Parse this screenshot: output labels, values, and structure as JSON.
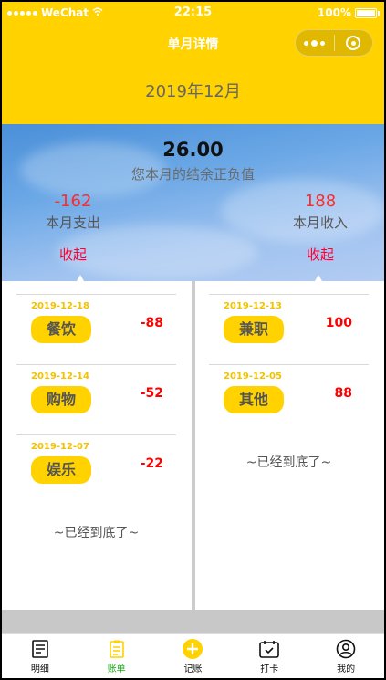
{
  "status_bar": {
    "carrier": "WeChat",
    "time": "22:15",
    "battery": "100%"
  },
  "nav": {
    "title": "单月详情"
  },
  "header": {
    "month": "2019年12月"
  },
  "summary": {
    "balance": "26.00",
    "balance_label": "您本月的结余正负值",
    "expense": {
      "value": "-162",
      "label": "本月支出",
      "fold": "收起"
    },
    "income": {
      "value": "188",
      "label": "本月收入",
      "fold": "收起"
    }
  },
  "expense_list": [
    {
      "date": "2019-12-18",
      "category": "餐饮",
      "amount": "-88"
    },
    {
      "date": "2019-12-14",
      "category": "购物",
      "amount": "-52"
    },
    {
      "date": "2019-12-07",
      "category": "娱乐",
      "amount": "-22"
    }
  ],
  "income_list": [
    {
      "date": "2019-12-13",
      "category": "兼职",
      "amount": "100"
    },
    {
      "date": "2019-12-05",
      "category": "其他",
      "amount": "88"
    }
  ],
  "list_end_text": "~已经到底了~",
  "tabbar": [
    {
      "label": "明细",
      "icon": "receipt-icon"
    },
    {
      "label": "账单",
      "icon": "bill-icon"
    },
    {
      "label": "记账",
      "icon": "add-icon"
    },
    {
      "label": "打卡",
      "icon": "calendar-icon"
    },
    {
      "label": "我的",
      "icon": "user-icon"
    }
  ],
  "colors": {
    "brand": "#FFD200",
    "active_tab": "#1aad19",
    "negative": "#ff0000"
  }
}
